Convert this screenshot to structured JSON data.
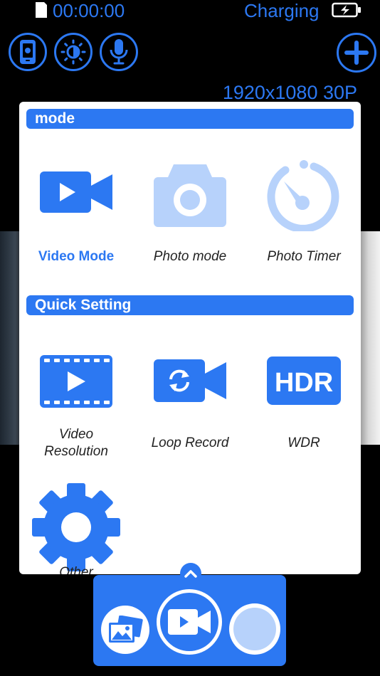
{
  "status": {
    "timer": "00:00:00",
    "charging": "Charging",
    "sd_icon": "sd-card-icon",
    "battery_icon": "battery-charging-icon"
  },
  "toolbar": {
    "buttons": [
      {
        "name": "camera-switch-icon"
      },
      {
        "name": "brightness-icon"
      },
      {
        "name": "microphone-icon"
      },
      {
        "name": "add-icon"
      }
    ],
    "resolution": "1920x1080 30P"
  },
  "panel": {
    "mode_header": "mode",
    "modes": [
      {
        "label": "Video Mode",
        "icon": "video-camera-icon",
        "active": true
      },
      {
        "label": "Photo mode",
        "icon": "photo-camera-icon",
        "active": false
      },
      {
        "label": "Photo Timer",
        "icon": "timer-icon",
        "active": false
      }
    ],
    "quick_header": "Quick Setting",
    "quick_settings": [
      {
        "label_line1": "Video",
        "label_line2": "Resolution",
        "icon": "video-resolution-icon"
      },
      {
        "label": "Loop Record",
        "icon": "loop-record-icon"
      },
      {
        "label": "WDR",
        "icon": "hdr-icon",
        "icon_text": "HDR"
      },
      {
        "label": "Other",
        "icon": "gear-icon"
      }
    ]
  },
  "bottom_bar": {
    "gallery_icon": "gallery-icon",
    "record_icon": "video-camera-icon",
    "shutter_icon": "shutter-icon",
    "expand_icon": "chevron-up-icon"
  },
  "colors": {
    "accent": "#2c78f2",
    "accent_light": "#b7d2fb",
    "background": "#000000",
    "panel": "#ffffff"
  }
}
